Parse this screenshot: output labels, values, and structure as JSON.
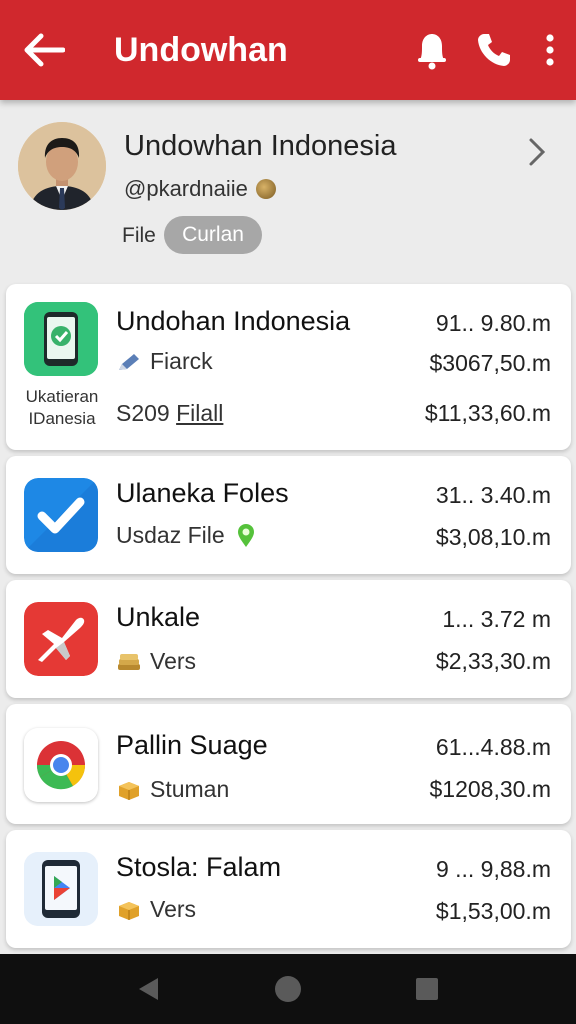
{
  "appbar": {
    "title": "Undowhan",
    "icons": {
      "back": "arrow-back-icon",
      "bell": "bell-icon",
      "phone": "phone-icon",
      "more": "more-vert-icon"
    },
    "color": "#d0282d"
  },
  "profile": {
    "name": "Undowhan Indonesia",
    "handle": "@pkardnaiie",
    "file_label": "File",
    "chip_label": "Curlan"
  },
  "items": [
    {
      "title": "Undohan Indonesia",
      "subtitle": "Fiarck",
      "size": "91.. 9.80.m",
      "price": "$3067,50.m",
      "icon_caption": "Ukatieran IDanesia",
      "extra_prefix": "S209",
      "extra_link": "Filall",
      "price2": "$11,33,60.m",
      "icon": "phone-app-icon"
    },
    {
      "title": "Ulaneka Foles",
      "subtitle": "Usdaz File",
      "size": "31.. 3.40.m",
      "price": "$3,08,10.m",
      "icon": "check-app-icon"
    },
    {
      "title": "Unkale",
      "subtitle": "Vers",
      "size": "1... 3.72 m",
      "price": "$2,33,30.m",
      "icon": "plane-app-icon"
    },
    {
      "title": "Pallin Suage",
      "subtitle": "Stuman",
      "size": "61...4.88.m",
      "price": "$1208,30.m",
      "icon": "chrome-app-icon"
    },
    {
      "title": "Stosla: Falam",
      "subtitle": "Vers",
      "size": "9 ... 9,88.m",
      "price": "$1,53,00.m",
      "icon": "play-tablet-app-icon"
    }
  ],
  "navbar": {
    "icons": [
      "nav-back-icon",
      "nav-home-icon",
      "nav-recents-icon"
    ]
  }
}
